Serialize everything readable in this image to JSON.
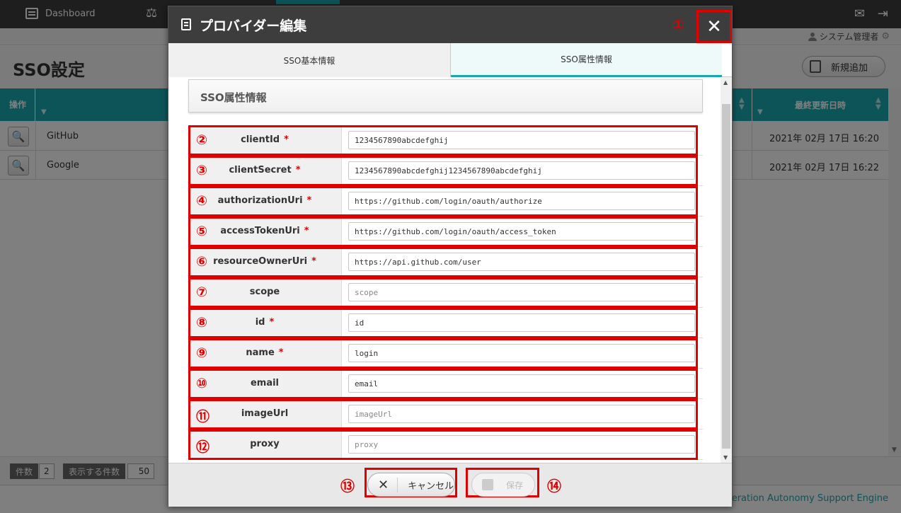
{
  "app": {
    "nav_dashboard": "Dashboard",
    "user_name": "システム管理者",
    "page_title": "SSO設定",
    "new_button": "新規追加",
    "footer_text": "eration Autonomy Support Engine"
  },
  "table": {
    "col_operation": "操作",
    "col_updated": "最終更新日時",
    "rows": [
      {
        "name": "GitHub",
        "updated": "2021年 02月 17日 16:20"
      },
      {
        "name": "Google",
        "updated": "2021年 02月 17日 16:22"
      }
    ]
  },
  "pager": {
    "count_label": "件数",
    "count_value": "2",
    "per_page_label": "表示する件数",
    "per_page_value": "50"
  },
  "modal": {
    "title": "プロバイダー編集",
    "close_symbol": "✕",
    "tabs": [
      "SSO基本情報",
      "SSO属性情報"
    ],
    "section_title": "SSO属性情報",
    "required_mark": "*",
    "fields": [
      {
        "label": "clientId",
        "value": "1234567890abcdefghij",
        "placeholder": "",
        "required": true
      },
      {
        "label": "clientSecret",
        "value": "1234567890abcdefghij1234567890abcdefghij",
        "placeholder": "",
        "required": true
      },
      {
        "label": "authorizationUri",
        "value": "https://github.com/login/oauth/authorize",
        "placeholder": "",
        "required": true
      },
      {
        "label": "accessTokenUri",
        "value": "https://github.com/login/oauth/access_token",
        "placeholder": "",
        "required": true
      },
      {
        "label": "resourceOwnerUri",
        "value": "https://api.github.com/user",
        "placeholder": "",
        "required": true
      },
      {
        "label": "scope",
        "value": "",
        "placeholder": "scope",
        "required": false
      },
      {
        "label": "id",
        "value": "id",
        "placeholder": "",
        "required": true
      },
      {
        "label": "name",
        "value": "login",
        "placeholder": "",
        "required": true
      },
      {
        "label": "email",
        "value": "email",
        "placeholder": "",
        "required": false
      },
      {
        "label": "imageUrl",
        "value": "",
        "placeholder": "imageUrl",
        "required": false
      },
      {
        "label": "proxy",
        "value": "",
        "placeholder": "proxy",
        "required": false
      }
    ],
    "cancel_label": "キャンセル",
    "save_label": "保存"
  },
  "callouts": [
    "①",
    "②",
    "③",
    "④",
    "⑤",
    "⑥",
    "⑦",
    "⑧",
    "⑨",
    "⑩",
    "⑪",
    "⑫",
    "⑬",
    "⑭"
  ],
  "colors": {
    "accent": "#18a8b0",
    "highlight": "#e00000",
    "header": "#3d3d3d"
  }
}
